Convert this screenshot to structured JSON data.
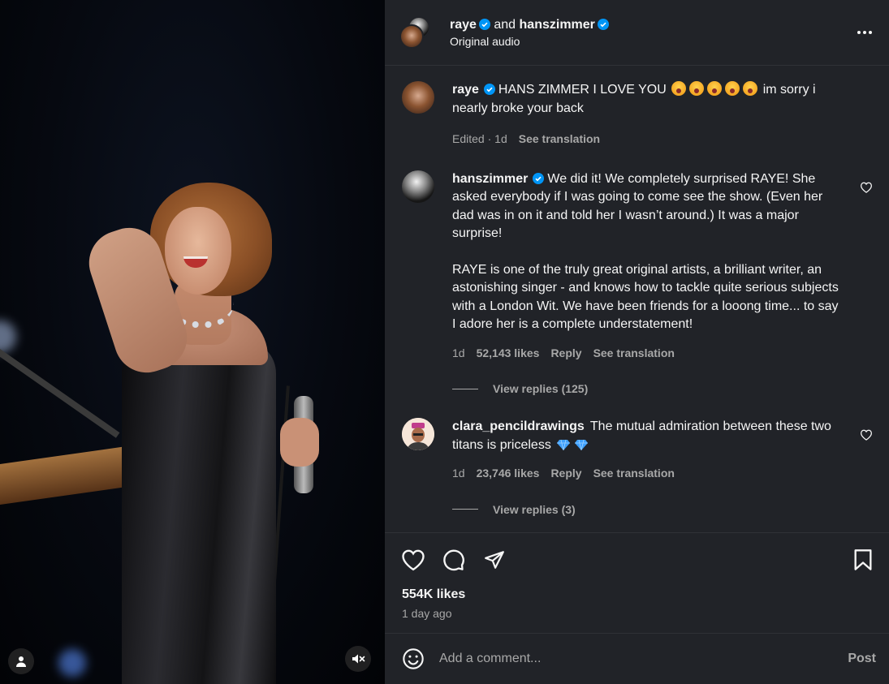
{
  "header": {
    "user1": "raye",
    "joiner": "and",
    "user2": "hanszimmer",
    "audio": "Original audio",
    "more_icon": "more-horizontal-icon"
  },
  "caption": {
    "user": "raye",
    "text_a": "HANS ZIMMER I LOVE YOU",
    "text_b": "im sorry i nearly broke your back",
    "emoji_count": 5,
    "edited": "Edited",
    "age": "1d",
    "translate": "See translation"
  },
  "comments": [
    {
      "user": "hanszimmer",
      "text": "We did it! We completely surprised RAYE! She asked everybody if I was going to come see the show. (Even her dad was in on it and told her I wasn’t around.) It was a major surprise!",
      "text2": "RAYE is one of the truly great original artists, a brilliant writer, an astonishing singer - and knows how to tackle quite serious subjects with a London Wit. We have been friends for a looong time... to say I adore her is a complete understatement!",
      "age": "1d",
      "likes": "52,143 likes",
      "reply": "Reply",
      "translate": "See translation",
      "view_replies": "View replies (125)"
    },
    {
      "user": "clara_pencildrawings",
      "text": "The mutual admiration between these two titans is priceless",
      "age": "1d",
      "likes": "23,746 likes",
      "reply": "Reply",
      "translate": "See translation",
      "view_replies": "View replies (3)"
    }
  ],
  "likes": "554K likes",
  "posted": "1 day ago",
  "composer": {
    "placeholder": "Add a comment...",
    "post": "Post"
  },
  "colors": {
    "panel_bg": "#212328",
    "verified": "#0095f6",
    "muted_text": "#a8a8a8"
  }
}
